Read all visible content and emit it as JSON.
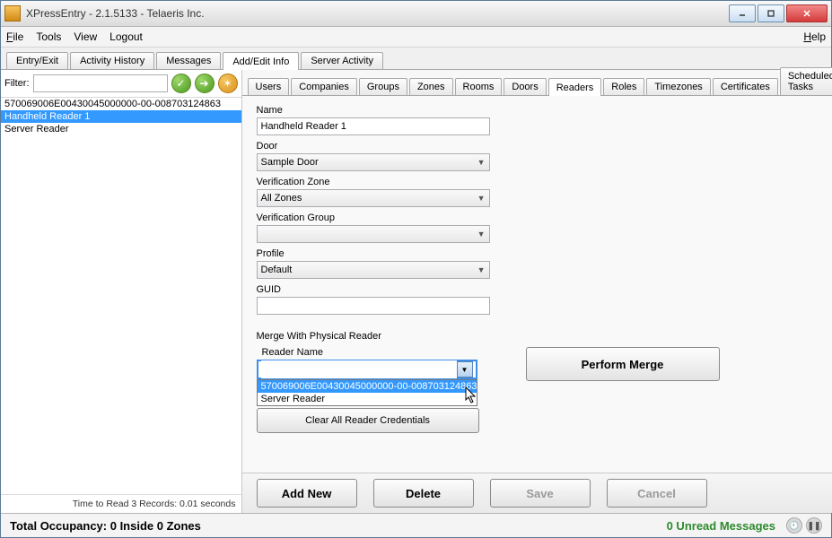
{
  "window": {
    "title": "XPressEntry - 2.1.5133 - Telaeris Inc."
  },
  "menubar": {
    "file": "File",
    "tools": "Tools",
    "view": "View",
    "logout": "Logout",
    "help": "Help"
  },
  "main_tabs": [
    "Entry/Exit",
    "Activity History",
    "Messages",
    "Add/Edit Info",
    "Server Activity"
  ],
  "main_tab_active": 3,
  "left": {
    "filter_label": "Filter:",
    "filter_value": "",
    "items": [
      "570069006E00430045000000-00-008703124863",
      "Handheld Reader 1",
      "Server Reader"
    ],
    "selected_index": 1,
    "footer": "Time to Read 3 Records: 0.01 seconds"
  },
  "sub_tabs": [
    "Users",
    "Companies",
    "Groups",
    "Zones",
    "Rooms",
    "Doors",
    "Readers",
    "Roles",
    "Timezones",
    "Certificates",
    "Scheduled Tasks"
  ],
  "sub_tab_active": 6,
  "form": {
    "name_label": "Name",
    "name_value": "Handheld Reader 1",
    "door_label": "Door",
    "door_value": "Sample Door",
    "vzone_label": "Verification Zone",
    "vzone_value": "All Zones",
    "vgroup_label": "Verification Group",
    "vgroup_value": "",
    "profile_label": "Profile",
    "profile_value": "Default",
    "guid_label": "GUID",
    "guid_value": ""
  },
  "merge": {
    "section_title": "Merge With Physical Reader",
    "reader_name_label": "Reader Name",
    "reader_name_value": "",
    "dropdown_options": [
      "570069006E00430045000000-00-008703124863",
      "Server Reader"
    ],
    "dropdown_highlight": 0,
    "perform_label": "Perform Merge",
    "clear_label": "Clear All Reader Credentials"
  },
  "actions": {
    "add_new": "Add New",
    "delete": "Delete",
    "save": "Save",
    "cancel": "Cancel"
  },
  "status": {
    "occupancy": "Total Occupancy: 0 Inside 0 Zones",
    "unread": "0 Unread Messages"
  }
}
